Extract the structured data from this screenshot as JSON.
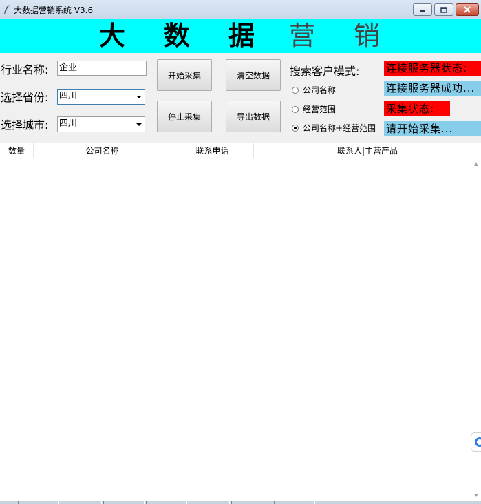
{
  "window": {
    "title": "大数据营销系统 V3.6"
  },
  "banner": {
    "chars": [
      "大",
      "数",
      "据",
      "营",
      "销"
    ]
  },
  "form": {
    "industry_label": "行业名称:",
    "industry_value": "企业",
    "province_label": "选择省份:",
    "province_value": "四川",
    "city_label": "选择城市:",
    "city_value": "四川"
  },
  "buttons": {
    "start": "开始采集",
    "stop": "停止采集",
    "clear": "清空数据",
    "export": "导出数据"
  },
  "search_mode": {
    "label": "搜索客户模式:",
    "options": [
      "公司名称",
      "经营范围",
      "公司名称+经营范围"
    ],
    "selected_index": 2
  },
  "status": {
    "server_label": "连接服务器状态:",
    "server_value": "连接服务器成功...",
    "collect_label": "采集状态:",
    "collect_value": "请开始采集..."
  },
  "table": {
    "columns": [
      "数量",
      "公司名称",
      "联系电话",
      "联系人|主营产品"
    ]
  },
  "colors": {
    "banner": "#00ffff",
    "status_label": "#ff0000",
    "status_value": "#87ceeb"
  }
}
